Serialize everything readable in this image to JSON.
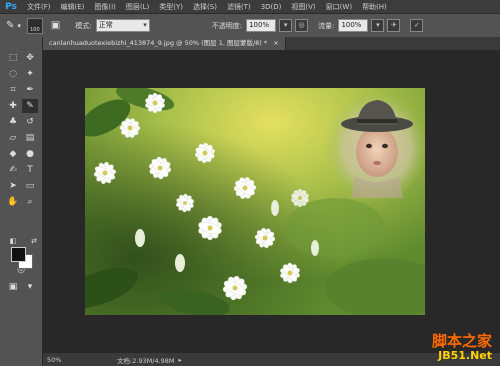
{
  "app": {
    "logo": "Ps"
  },
  "menu": [
    "文件(F)",
    "编辑(E)",
    "图像(I)",
    "图层(L)",
    "类型(Y)",
    "选择(S)",
    "滤镜(T)",
    "3D(D)",
    "视图(V)",
    "窗口(W)",
    "帮助(H)"
  ],
  "options": {
    "brush_size": "100",
    "mode_label": "模式:",
    "mode_value": "正常",
    "opacity_label": "不透明度:",
    "opacity_value": "100%",
    "flow_label": "流量:",
    "flow_value": "100%"
  },
  "tab": {
    "title": "canlanhuaduotexiebizhi_413874_9.jpg @ 50% (图层 1, 图层蒙版/8) *",
    "close": "×"
  },
  "status": {
    "zoom": "50%",
    "doc": "文档:2.93M/4.98M"
  },
  "watermark": {
    "line1": "脚本之家",
    "line2": "JB51.Net"
  },
  "colors": {
    "foreground": "#111111",
    "background": "#ffffff",
    "accent": "#31a8ff"
  }
}
